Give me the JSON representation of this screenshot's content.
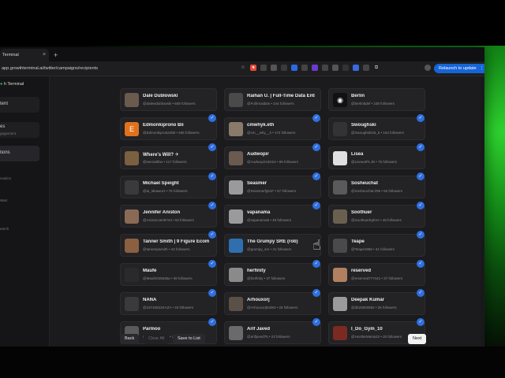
{
  "browser": {
    "tab_title": "Terminal",
    "tab_close": "×",
    "new_tab": "+",
    "url": "app.growthterminal.ai/twitter/campaigns/recipients",
    "relaunch_label": "Relaunch to update",
    "relaunch_menu": "⋮"
  },
  "sidebar": {
    "brand": "h Terminal",
    "items": [
      {
        "label": "tent"
      },
      {
        "label": "es"
      },
      {
        "label": "gagement"
      },
      {
        "label": "tions"
      },
      {
        "label": "nostics"
      },
      {
        "label": "Wait"
      },
      {
        "label": "earch"
      }
    ]
  },
  "recipients": [
    {
      "name": "Dale Dublowski",
      "handle": "@dalewdublowski • 509 followers",
      "avatar_color": "#6b5b4e",
      "avatar_letter": "",
      "checked": false
    },
    {
      "name": "Raihan U. | Full-Time Data Entr..",
      "handle": "@Fullrmaidain • 244 followers",
      "avatar_color": "#4a4a4a",
      "avatar_letter": "",
      "checked": false
    },
    {
      "name": "Berlin",
      "handle": "@berlinbdef • 238 followers",
      "avatar_color": "#111111",
      "avatar_letter": "◉",
      "checked": false
    },
    {
      "name": "Edmonkiprono Bii",
      "handle": "@Edmonkipro52288 • 266 followers",
      "avatar_color": "#e2711d",
      "avatar_letter": "E",
      "checked": true
    },
    {
      "name": "cmwhyk.eth",
      "handle": "@cm__why__k • 172 followers",
      "avatar_color": "#8a7a6a",
      "avatar_letter": "",
      "checked": true
    },
    {
      "name": "Swoughski",
      "handle": "@Swoughski25_6 • 164 followers",
      "avatar_color": "#333333",
      "avatar_letter": "",
      "checked": true
    },
    {
      "name": "Where's Will? ✈",
      "handle": "@wemattfao • 117 followers",
      "avatar_color": "#7a6040",
      "avatar_letter": "",
      "checked": true
    },
    {
      "name": "Audwopir",
      "handle": "@Audwopir4461ts • 85 followers",
      "avatar_color": "#6a5a50",
      "avatar_letter": "",
      "checked": true
    },
    {
      "name": "Lisea",
      "handle": "@LiseaotPLJN • 75 followers",
      "avatar_color": "#e0e0e0",
      "avatar_letter": "",
      "checked": true
    },
    {
      "name": "Michael Speight",
      "handle": "@ai_ideaworx • 76 followers",
      "avatar_color": "#3a3a3a",
      "avatar_letter": "",
      "checked": true
    },
    {
      "name": "Seasmer",
      "handle": "@Seasmerfg61F • 67 followers",
      "avatar_color": "#9a9a9a",
      "avatar_letter": "",
      "checked": true
    },
    {
      "name": "Sosheuchat",
      "handle": "@Sosheuchat.lr95 • 65 followers",
      "avatar_color": "#5a5a5a",
      "avatar_letter": "",
      "checked": true
    },
    {
      "name": "Jennifer Aniston",
      "handle": "@AnistonJen9744 • 63 followers",
      "avatar_color": "#8a6a55",
      "avatar_letter": "",
      "checked": true
    },
    {
      "name": "vapanama",
      "handle": "@vapanama5 • 49 followers",
      "avatar_color": "#9a9a9a",
      "avatar_letter": "",
      "checked": true
    },
    {
      "name": "Soothuer",
      "handle": "@SoothuerEykVA • 48 followers",
      "avatar_color": "#6a6050",
      "avatar_letter": "",
      "checked": true
    },
    {
      "name": "Tanner Smith | 9 Figure Ecom",
      "handle": "@tannerpwmith • 43 followers",
      "avatar_color": "#8a6040",
      "avatar_letter": "",
      "checked": true
    },
    {
      "name": "The Grumpy SRE (rob)",
      "handle": "@grumpy_sre • 41 followers",
      "avatar_color": "#2f6fb0",
      "avatar_letter": "",
      "checked": false
    },
    {
      "name": "Teape",
      "handle": "@Teape1866 • 41 followers",
      "avatar_color": "#4a4a4a",
      "avatar_letter": "",
      "checked": true
    },
    {
      "name": "Maufe",
      "handle": "@Maufe025636a • 39 followers",
      "avatar_color": "#2a2a2a",
      "avatar_letter": "",
      "checked": true
    },
    {
      "name": "herfinity",
      "handle": "@herfinity • 37 followers",
      "avatar_color": "#8a8a8a",
      "avatar_letter": "",
      "checked": true
    },
    {
      "name": "reserved",
      "handle": "@reserved777441 • 37 followers",
      "avatar_color": "#b08060",
      "avatar_letter": "",
      "checked": true
    },
    {
      "name": "NANA",
      "handle": "@19740622KAZA • 33 followers",
      "avatar_color": "#3a3a3a",
      "avatar_letter": "",
      "checked": true
    },
    {
      "name": "Arhouxorj",
      "handle": "@Arhouxorj83494 • 26 followers",
      "avatar_color": "#5a5048",
      "avatar_letter": "",
      "checked": true
    },
    {
      "name": "Deepak Kumar",
      "handle": "@db25800892 • 26 followers",
      "avatar_color": "#9a9a9a",
      "avatar_letter": "",
      "checked": true
    },
    {
      "name": "Parmoo",
      "handle": "@Parmoo47666 • 23 followers",
      "avatar_color": "#5a5a5a",
      "avatar_letter": "",
      "checked": true
    },
    {
      "name": "Arif Javed",
      "handle": "@arifjaved76 • 23 followers",
      "avatar_color": "#6a6a6a",
      "avatar_letter": "",
      "checked": true
    },
    {
      "name": "I_Do_Gym_10",
      "handle": "@HustlerMania10 • 20 followers",
      "avatar_color": "#7a2a20",
      "avatar_letter": "",
      "checked": true
    }
  ],
  "actions": {
    "back": "Back",
    "clear_all": "Clear All",
    "save_to_list": "Save to List",
    "next": "Next"
  },
  "colors": {
    "accent": "#2f6fe0",
    "relaunch": "#1565d8",
    "brand_green": "#22c55e"
  }
}
